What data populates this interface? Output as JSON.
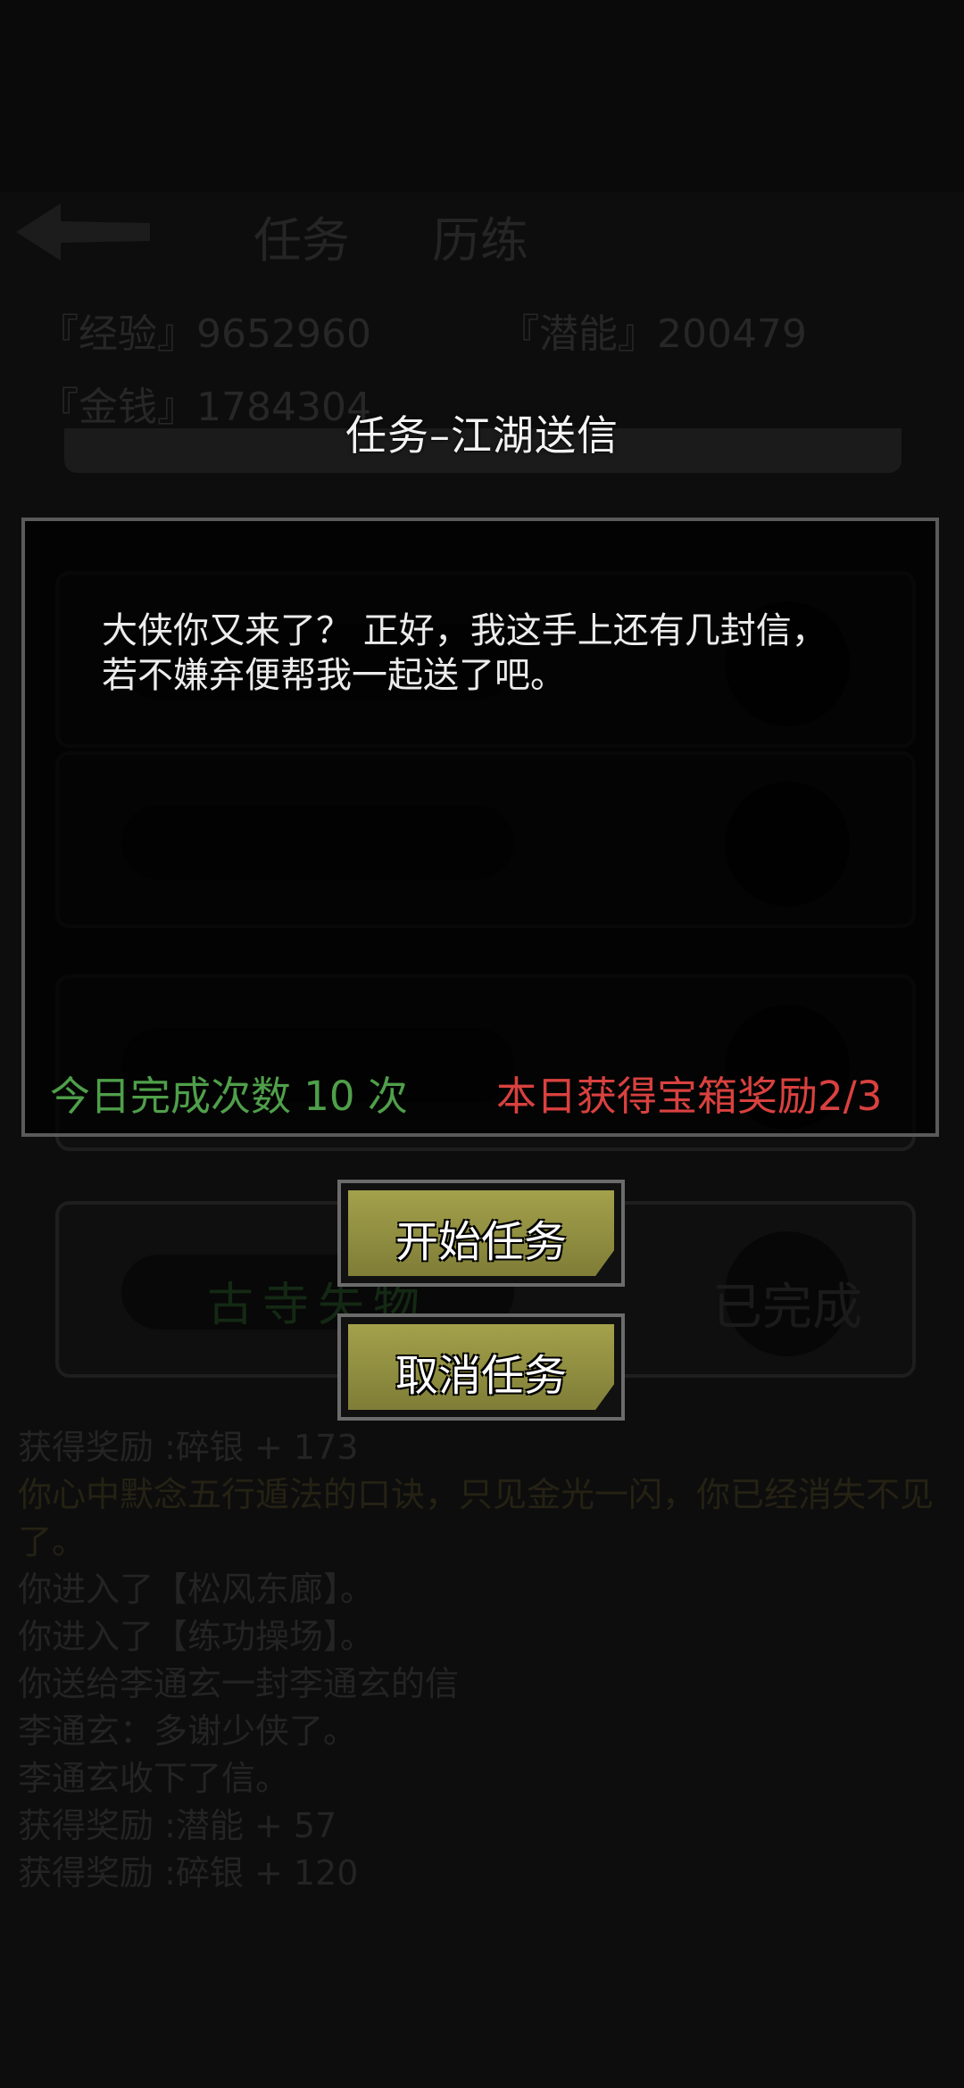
{
  "background": {
    "tabs": [
      "任务",
      "历练"
    ],
    "stats": {
      "exp_label": "『经验』",
      "exp_value": "9652960",
      "potential_label": "『潜能』",
      "potential_value": "200479",
      "money_label": "『金钱』",
      "money_value": "1784304"
    },
    "tasks": [
      {
        "name": "古寺失物",
        "status": "已完成"
      }
    ],
    "log": [
      "获得奖励 :碎银 + 173",
      "你心中默念五行遁法的口诀，只见金光一闪，你已经消失不见了。",
      "你进入了【松风东廊】。",
      "你进入了【练功操场】。",
      "你送给李通玄一封李通玄的信",
      "李通玄：多谢少侠了。",
      "李通玄收下了信。",
      "获得奖励 :潜能 + 57",
      "获得奖励 :碎银 + 120"
    ]
  },
  "dialog": {
    "title": "任务–江湖送信",
    "message": "大侠你又来了？ 正好，我这手上还有几封信，若不嫌弃便帮我一起送了吧。",
    "completed_today": "今日完成次数 10 次",
    "chest_reward": "本日获得宝箱奖励2/3",
    "start_button": "开始任务",
    "cancel_button": "取消任务"
  },
  "colors": {
    "green": "#4f9f4a",
    "red": "#d9413f",
    "button": "#a3a14b"
  }
}
